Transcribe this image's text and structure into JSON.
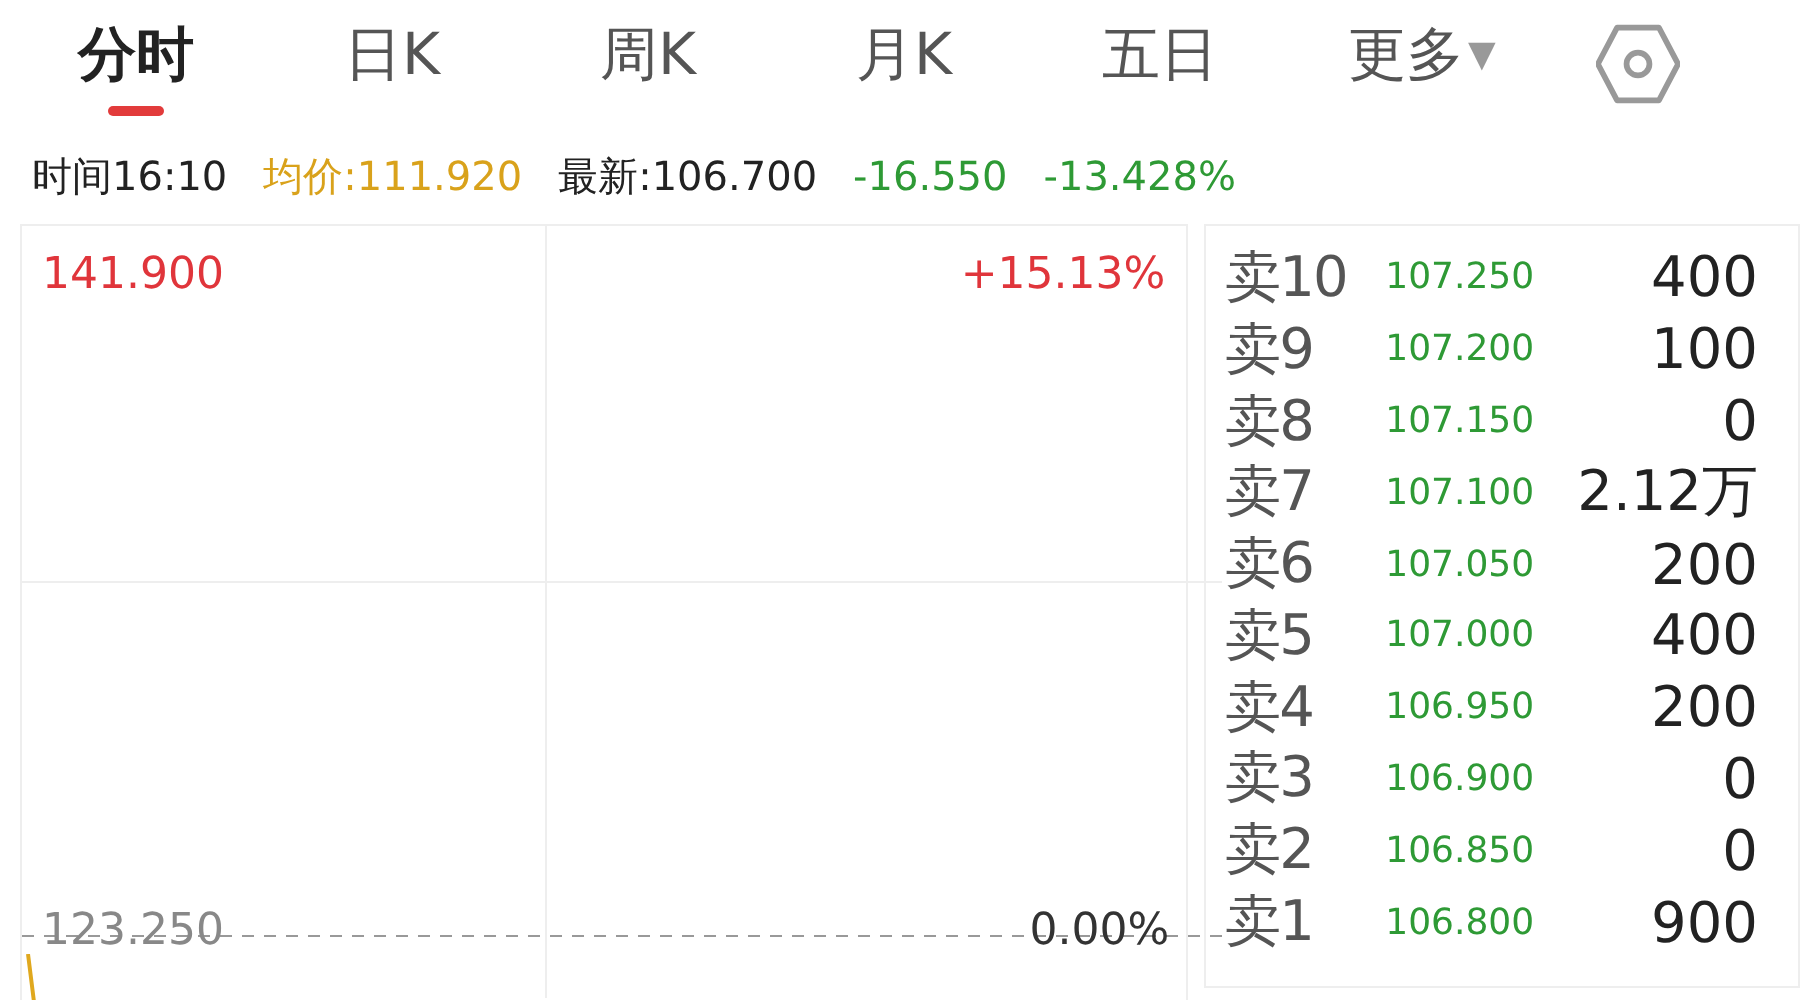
{
  "tabs": [
    {
      "label": "分时",
      "selected": true
    },
    {
      "label": "日K",
      "selected": false
    },
    {
      "label": "周K",
      "selected": false
    },
    {
      "label": "月K",
      "selected": false
    },
    {
      "label": "五日",
      "selected": false
    }
  ],
  "more_menu": {
    "label": "更多",
    "caret": "▼"
  },
  "quote": [
    {
      "kind": "plain",
      "text": "时间16:10"
    },
    {
      "kind": "average",
      "text": "均价:111.920"
    },
    {
      "kind": "plain",
      "text": "最新:106.700"
    },
    {
      "kind": "down",
      "text": "-16.550"
    },
    {
      "kind": "down",
      "text": "-13.428%"
    }
  ],
  "chart": {
    "top_price": "141.900",
    "top_change": "+15.13%",
    "base_price": "123.250",
    "base_change": "0.00%"
  },
  "order_book": [
    {
      "label": "卖10",
      "price": "107.250",
      "volume": "400"
    },
    {
      "label": "卖9",
      "price": "107.200",
      "volume": "100"
    },
    {
      "label": "卖8",
      "price": "107.150",
      "volume": "0"
    },
    {
      "label": "卖7",
      "price": "107.100",
      "volume": "2.12万"
    },
    {
      "label": "卖6",
      "price": "107.050",
      "volume": "200"
    },
    {
      "label": "卖5",
      "price": "107.000",
      "volume": "400"
    },
    {
      "label": "卖4",
      "price": "106.950",
      "volume": "200"
    },
    {
      "label": "卖3",
      "price": "106.900",
      "volume": "0"
    },
    {
      "label": "卖2",
      "price": "106.850",
      "volume": "0"
    },
    {
      "label": "卖1",
      "price": "106.800",
      "volume": "900"
    }
  ]
}
